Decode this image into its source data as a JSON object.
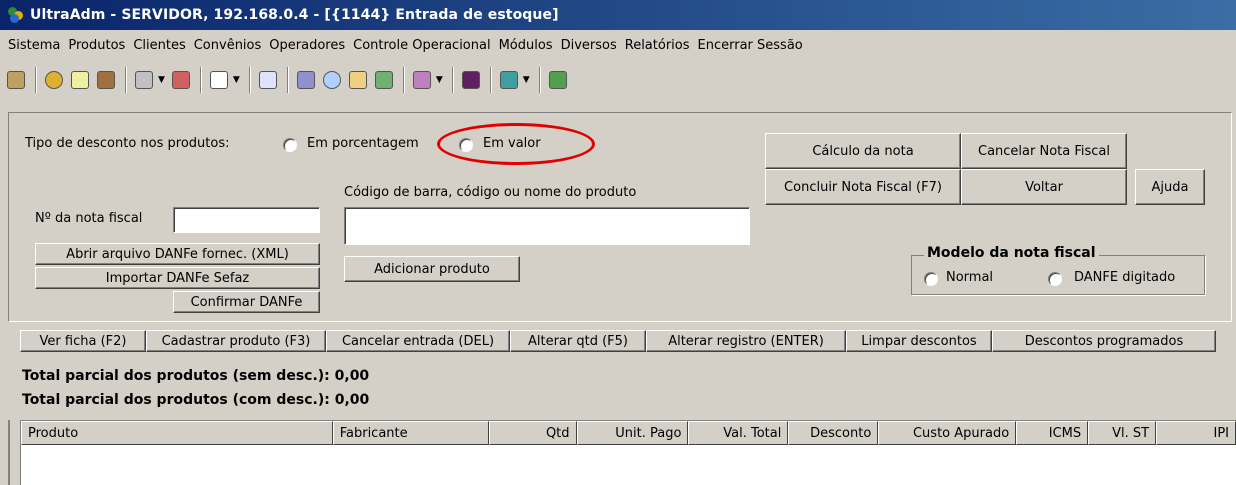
{
  "window": {
    "title": "UltraAdm - SERVIDOR, 192.168.0.4 - [{1144} Entrada de estoque]"
  },
  "menu": {
    "items": [
      {
        "label": "Sistema"
      },
      {
        "label": "Produtos"
      },
      {
        "label": "Clientes"
      },
      {
        "label": "Convênios"
      },
      {
        "label": "Operadores"
      },
      {
        "label": "Controle Operacional"
      },
      {
        "label": "Módulos"
      },
      {
        "label": "Diversos"
      },
      {
        "label": "Relatórios"
      },
      {
        "label": "Encerrar Sessão"
      }
    ]
  },
  "toolbar": {
    "icons": [
      "exit-icon",
      "globe-icon",
      "calendar-icon",
      "trash-icon",
      "pencil-icon",
      "edit-icon",
      "hand-icon",
      "printer-icon",
      "pen-icon",
      "magnifier-icon",
      "refresh-icon",
      "chart-icon",
      "palette-icon",
      "graph-icon",
      "gift-icon",
      "door-icon"
    ]
  },
  "discount": {
    "label": "Tipo de desconto nos produtos:",
    "option_percent": "Em porcentagem",
    "option_value": "Em valor",
    "highlight_color": "#e00000"
  },
  "invoice": {
    "number_label": "Nº da nota fiscal",
    "number_value": "",
    "open_xml_button": "Abrir arquivo DANFe fornec. (XML)",
    "import_button": "Importar DANFe Sefaz",
    "confirm_button": "Confirmar DANFe"
  },
  "product": {
    "search_label": "Código de barra, código ou nome do produto",
    "search_value": "",
    "add_button": "Adicionar produto"
  },
  "actions": {
    "calc_button": "Cálculo da nota",
    "cancel_invoice_button": "Cancelar Nota Fiscal",
    "conclude_button": "Concluir Nota Fiscal (F7)",
    "back_button": "Voltar",
    "help_button": "Ajuda"
  },
  "model": {
    "title": "Modelo da nota fiscal",
    "option_normal": "Normal",
    "option_danfe": "DANFE digitado"
  },
  "actionbar": {
    "items": [
      {
        "label": "Ver ficha (F2)"
      },
      {
        "label": "Cadastrar produto (F3)"
      },
      {
        "label": "Cancelar entrada (DEL)"
      },
      {
        "label": "Alterar qtd (F5)"
      },
      {
        "label": "Alterar registro (ENTER)"
      },
      {
        "label": "Limpar descontos"
      },
      {
        "label": "Descontos programados"
      }
    ]
  },
  "totals": {
    "without_discount": "Total parcial dos produtos (sem desc.): 0,00",
    "with_discount": "Total parcial dos produtos (com desc.): 0,00"
  },
  "grid": {
    "columns": [
      {
        "label": "Produto"
      },
      {
        "label": "Fabricante"
      },
      {
        "label": "Qtd"
      },
      {
        "label": "Unit. Pago"
      },
      {
        "label": "Val. Total"
      },
      {
        "label": "Desconto"
      },
      {
        "label": "Custo Apurado"
      },
      {
        "label": "ICMS"
      },
      {
        "label": "Vl. ST"
      },
      {
        "label": "IPI"
      }
    ],
    "rows": []
  }
}
